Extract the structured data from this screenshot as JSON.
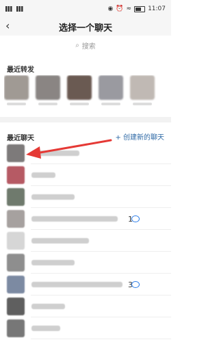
{
  "status": {
    "time": "11:07"
  },
  "header": {
    "title": "选择一个聊天"
  },
  "search": {
    "placeholder": "搜索"
  },
  "sections": {
    "recent_forward": "最近转发",
    "recent_chats": "最近聊天",
    "new_chat": "+ 创建新的聊天"
  },
  "forward_items": [
    {
      "color": "#a09a94"
    },
    {
      "color": "#8a8583"
    },
    {
      "color": "#6a5a52"
    },
    {
      "color": "#9a9aa0"
    },
    {
      "color": "#c0b9b4"
    }
  ],
  "chat_rows": [
    {
      "avatar_color": "#7d7a7a",
      "name_width": 0.5,
      "badge": ""
    },
    {
      "avatar_color": "#b65a64",
      "name_width": 0.25,
      "badge": ""
    },
    {
      "avatar_color": "#6f7a6d",
      "name_width": 0.45,
      "badge": ""
    },
    {
      "avatar_color": "#a6a19f",
      "name_width": 0.9,
      "badge": "1"
    },
    {
      "avatar_color": "#d6d6d6",
      "name_width": 0.6,
      "badge": ""
    },
    {
      "avatar_color": "#8e8e8e",
      "name_width": 0.45,
      "badge": ""
    },
    {
      "avatar_color": "#7c8aa2",
      "name_width": 0.95,
      "badge": "3"
    },
    {
      "avatar_color": "#5f5f5f",
      "name_width": 0.35,
      "badge": ""
    },
    {
      "avatar_color": "#777777",
      "name_width": 0.3,
      "badge": ""
    }
  ],
  "annotation": {
    "arrow_color": "#e53935"
  }
}
